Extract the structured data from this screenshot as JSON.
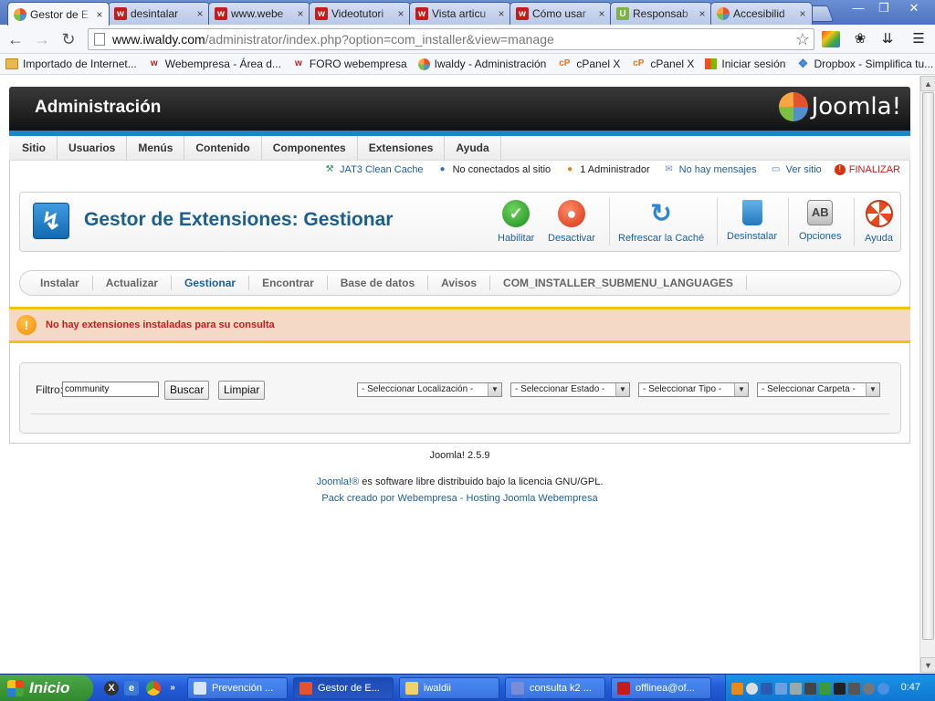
{
  "browser": {
    "tabs": [
      {
        "title": "Gestor de E",
        "favicon": "joomla",
        "active": true
      },
      {
        "title": "desintalar",
        "favicon": "webe"
      },
      {
        "title": "www.webe",
        "favicon": "webe"
      },
      {
        "title": "Videotutori",
        "favicon": "webe"
      },
      {
        "title": "Vista articu",
        "favicon": "webe"
      },
      {
        "title": "Cómo usar",
        "favicon": "webe"
      },
      {
        "title": "Responsab",
        "favicon": "uniandes"
      },
      {
        "title": "Accesibilid",
        "favicon": "joomla"
      }
    ],
    "url_host": "www.iwaldy.com",
    "url_path": "/administrator/index.php?option=com_installer&view=manage",
    "bookmarks": [
      {
        "label": "Importado de Internet...",
        "icon": "folder"
      },
      {
        "label": "Webempresa - Área d...",
        "icon": "w"
      },
      {
        "label": "FORO webempresa",
        "icon": "w"
      },
      {
        "label": "Iwaldy - Administración",
        "icon": "jm"
      },
      {
        "label": "cPanel X",
        "icon": "cp"
      },
      {
        "label": "cPanel X",
        "icon": "cp"
      },
      {
        "label": "Iniciar sesión",
        "icon": "ms"
      },
      {
        "label": "Dropbox - Simplifica tu...",
        "icon": "db"
      }
    ]
  },
  "joomla": {
    "header_title": "Administración",
    "logo_text": "Joomla!",
    "menu": [
      "Sitio",
      "Usuarios",
      "Menús",
      "Contenido",
      "Componentes",
      "Extensiones",
      "Ayuda"
    ],
    "status": {
      "cache": "JAT3 Clean Cache",
      "visitors": "No conectados al sitio",
      "admins": "1 Administrador",
      "messages": "No hay mensajes",
      "view_site": "Ver sitio",
      "logout": "FINALIZAR"
    },
    "page_title": "Gestor de Extensiones: Gestionar",
    "toolbar": {
      "enable": "Habilitar",
      "disable": "Desactivar",
      "refresh": "Refrescar la Caché",
      "uninstall": "Desinstalar",
      "options": "Opciones",
      "options_glyph": "AB",
      "help": "Ayuda"
    },
    "subnav": [
      {
        "label": "Instalar"
      },
      {
        "label": "Actualizar"
      },
      {
        "label": "Gestionar",
        "active": true
      },
      {
        "label": "Encontrar"
      },
      {
        "label": "Base de datos"
      },
      {
        "label": "Avisos"
      },
      {
        "label": "COM_INSTALLER_SUBMENU_LANGUAGES"
      }
    ],
    "notice": "No hay extensiones instaladas para su consulta",
    "filter": {
      "label": "Filtro:",
      "value": "community",
      "search_btn": "Buscar",
      "clear_btn": "Limpiar",
      "selects": [
        "- Seleccionar Localización -",
        "- Seleccionar Estado -",
        "- Seleccionar Tipo -",
        "- Seleccionar Carpeta -"
      ]
    },
    "footer": {
      "version": "Joomla! 2.5.9",
      "license_link": "Joomla!®",
      "license_text": " es software libre distribuido bajo la licencia GNU/GPL.",
      "pack_link": "Pack creado por Webempresa",
      "sep": " - ",
      "hosting_link": "Hosting Joomla Webempresa"
    }
  },
  "taskbar": {
    "start_label": "Inicio",
    "tasks": [
      {
        "label": "Prevención ...",
        "color": "#d8e4f8"
      },
      {
        "label": "Gestor de E...",
        "color": "#e4532b",
        "active": true
      },
      {
        "label": "iwaldii",
        "color": "#f2d16b"
      },
      {
        "label": "consulta k2 ...",
        "color": "#7a8bd8"
      },
      {
        "label": "offlinea@of...",
        "color": "#c41c1c"
      }
    ],
    "clock": "0:47"
  }
}
